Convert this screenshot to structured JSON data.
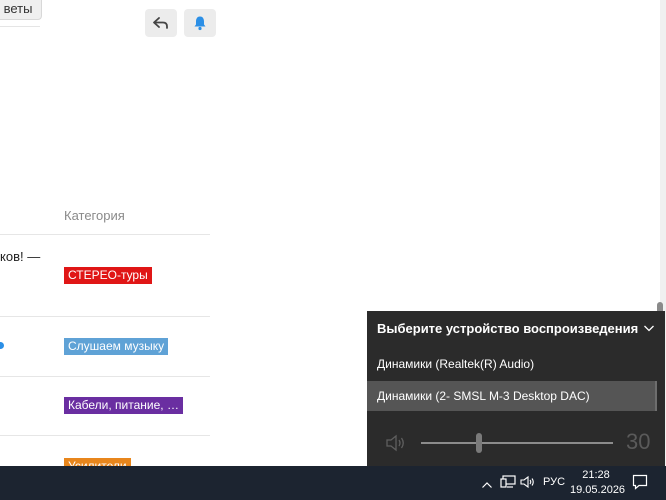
{
  "page": {
    "answers_label": "веты",
    "category_header": "Категория",
    "rows": [
      {
        "text": "ков! —",
        "tag": "СТЕРЕО-туры",
        "tag_color": "#e01616"
      },
      {
        "text": "",
        "tag": "Слушаем музыку",
        "tag_color": "#5fa2d6"
      },
      {
        "text": "",
        "tag": "Кабели, питание, …",
        "tag_color": "#6a2ea1"
      },
      {
        "text": "",
        "tag": "Усилители",
        "tag_color": "#e8861c"
      }
    ]
  },
  "flyout": {
    "title": "Выберите устройство воспроизведения",
    "devices": [
      "Динамики (Realtek(R) Audio)",
      "Динамики (2- SMSL M-3 Desktop DAC)"
    ],
    "selected_index": 1,
    "volume": 30,
    "volume_fraction": 0.3
  },
  "taskbar": {
    "language": "РУС",
    "time": "21:28",
    "date": "19.05.2026"
  },
  "icons": [
    "reply-icon",
    "bell-icon",
    "chevron-down-icon",
    "speaker-icon",
    "chevron-up-icon",
    "network-icon",
    "volume-icon",
    "notification-icon"
  ]
}
